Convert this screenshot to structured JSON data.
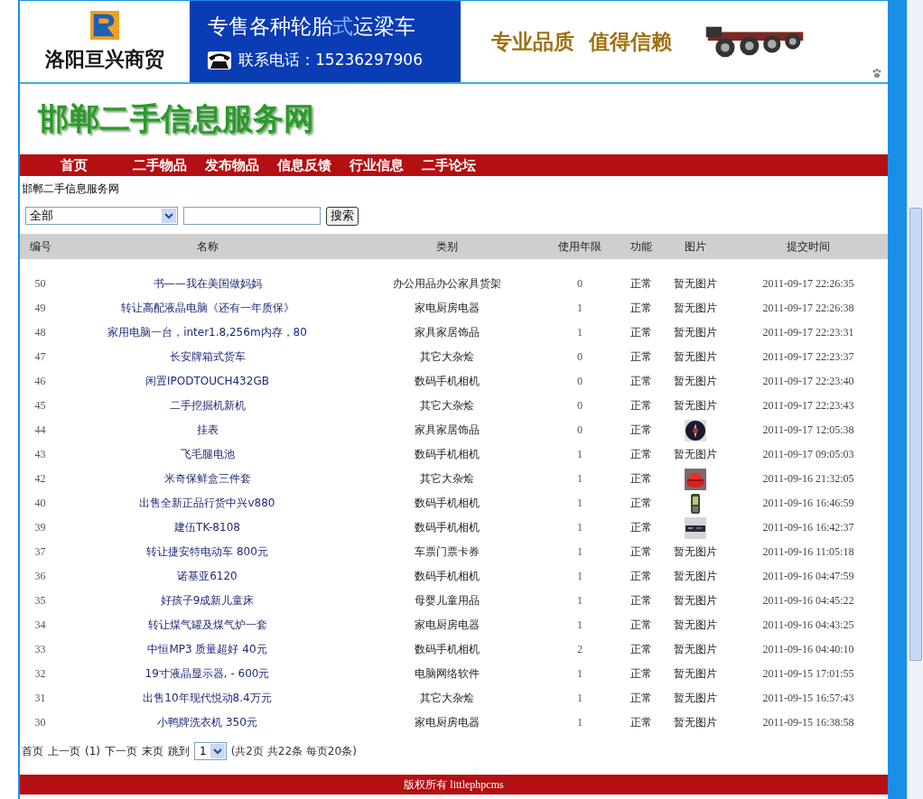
{
  "banner": {
    "company": "洛阳亘兴商贸",
    "headline": [
      {
        "text": "专售各种轮胎",
        "highlight": false
      },
      {
        "text": "式",
        "highlight": true
      },
      {
        "text": "运梁车",
        "highlight": false
      }
    ],
    "phone": "联系电话：15236297906",
    "slogan": "专业品质  值得信赖"
  },
  "site_title": "邯郸二手信息服务网",
  "nav": [
    "首页",
    "二手物品",
    "发布物品",
    "信息反馈",
    "行业信息",
    "二手论坛"
  ],
  "breadcrumb": "邯郸二手信息服务网",
  "search": {
    "category": "全部",
    "button": "搜索"
  },
  "table": {
    "columns": [
      "编号",
      "名称",
      "类别",
      "使用年限",
      "功能",
      "图片",
      "提交时间"
    ],
    "rows": [
      {
        "id": "50",
        "name": "书——我在美国做妈妈",
        "category": "办公用品办公家具货架",
        "years": "0",
        "status": "正常",
        "image": {
          "kind": "text",
          "text": "暂无图片"
        },
        "time": "2011-09-17 22:26:35"
      },
      {
        "id": "49",
        "name": "转让高配液晶电脑《还有一年质保》",
        "category": "家电厨房电器",
        "years": "1",
        "status": "正常",
        "image": {
          "kind": "text",
          "text": "暂无图片"
        },
        "time": "2011-09-17 22:26:38"
      },
      {
        "id": "48",
        "name": "家用电脑一台，inter1.8,256m内存，80",
        "category": "家具家居饰品",
        "years": "1",
        "status": "正常",
        "image": {
          "kind": "text",
          "text": "暂无图片"
        },
        "time": "2011-09-17 22:23:31"
      },
      {
        "id": "47",
        "name": "长安牌箱式货车",
        "category": "其它大杂烩",
        "years": "0",
        "status": "正常",
        "image": {
          "kind": "text",
          "text": "暂无图片"
        },
        "time": "2011-09-17 22:23:37"
      },
      {
        "id": "46",
        "name": "闲置IPODTOUCH432GB",
        "category": "数码手机相机",
        "years": "0",
        "status": "正常",
        "image": {
          "kind": "text",
          "text": "暂无图片"
        },
        "time": "2011-09-17 22:23:40"
      },
      {
        "id": "45",
        "name": "二手挖掘机新机",
        "category": "其它大杂烩",
        "years": "0",
        "status": "正常",
        "image": {
          "kind": "text",
          "text": "暂无图片"
        },
        "time": "2011-09-17 22:23:43"
      },
      {
        "id": "44",
        "name": "挂表",
        "category": "家具家居饰品",
        "years": "0",
        "status": "正常",
        "time": "2011-09-17 12:05:38"
      },
      {
        "id": "43",
        "name": "飞毛腿电池",
        "category": "数码手机相机",
        "years": "1",
        "status": "正常",
        "image": {
          "kind": "text",
          "text": "暂无图片"
        },
        "time": "2011-09-17 09:05:03"
      },
      {
        "id": "42",
        "name": "米奇保鲜盒三件套",
        "category": "其它大杂烩",
        "years": "1",
        "status": "正常",
        "time": "2011-09-16 21:32:05"
      },
      {
        "id": "40",
        "name": "出售全新正品行货中兴v880",
        "category": "数码手机相机",
        "years": "1",
        "status": "正常",
        "time": "2011-09-16 16:46:59"
      },
      {
        "id": "39",
        "name": "建伍TK-8108",
        "category": "数码手机相机",
        "years": "1",
        "status": "正常",
        "time": "2011-09-16 16:42:37"
      },
      {
        "id": "37",
        "name": "转让捷安特电动车 800元",
        "category": "车票门票卡券",
        "years": "1",
        "status": "正常",
        "image": {
          "kind": "text",
          "text": "暂无图片"
        },
        "time": "2011-09-16 11:05:18"
      },
      {
        "id": "36",
        "name": "诺基亚6120",
        "category": "数码手机相机",
        "years": "1",
        "status": "正常",
        "image": {
          "kind": "text",
          "text": "暂无图片"
        },
        "time": "2011-09-16 04:47:59"
      },
      {
        "id": "35",
        "name": "好孩子9成新儿童床",
        "category": "母婴儿童用品",
        "years": "1",
        "status": "正常",
        "image": {
          "kind": "text",
          "text": "暂无图片"
        },
        "time": "2011-09-16 04:45:22"
      },
      {
        "id": "34",
        "name": "转让煤气罐及煤气炉一套",
        "category": "家电厨房电器",
        "years": "1",
        "status": "正常",
        "image": {
          "kind": "text",
          "text": "暂无图片"
        },
        "time": "2011-09-16 04:43:25"
      },
      {
        "id": "33",
        "name": "中恒MP3 质量超好 40元",
        "category": "数码手机相机",
        "years": "2",
        "status": "正常",
        "image": {
          "kind": "text",
          "text": "暂无图片"
        },
        "time": "2011-09-16 04:40:10"
      },
      {
        "id": "32",
        "name": "19寸液晶显示器, - 600元",
        "category": "电脑网络软件",
        "years": "1",
        "status": "正常",
        "image": {
          "kind": "text",
          "text": "暂无图片"
        },
        "time": "2011-09-15 17:01:55"
      },
      {
        "id": "31",
        "name": "出售10年现代悦动8.4万元",
        "category": "其它大杂烩",
        "years": "1",
        "status": "正常",
        "image": {
          "kind": "text",
          "text": "暂无图片"
        },
        "time": "2011-09-15 16:57:43"
      },
      {
        "id": "30",
        "name": "小鸭牌洗衣机 350元",
        "category": "家电厨房电器",
        "years": "1",
        "status": "正常",
        "image": {
          "kind": "text",
          "text": "暂无图片"
        },
        "time": "2011-09-15 16:38:58"
      }
    ]
  },
  "pagination": {
    "links": [
      "首页",
      "上一页",
      "(1)",
      "下一页",
      "末页"
    ],
    "jump_label": "跳到",
    "page": "1",
    "summary": "(共2页 共22条 每页20条)"
  },
  "footer": "版权所有 littlephpcms"
}
